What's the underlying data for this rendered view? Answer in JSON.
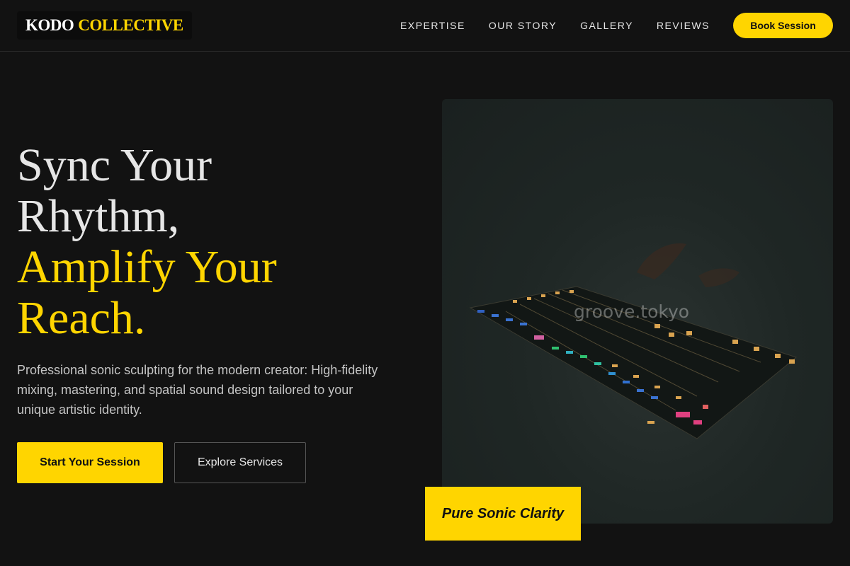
{
  "brand": {
    "name": "KODO",
    "accent": "COLLECTIVE"
  },
  "nav": {
    "links": [
      "EXPERTISE",
      "OUR STORY",
      "GALLERY",
      "REVIEWS"
    ],
    "cta": "Book Session"
  },
  "hero": {
    "title_lines": [
      "Sync Your",
      "Rhythm,"
    ],
    "title_accent_lines": [
      "Amplify Your",
      "Reach."
    ],
    "description": "Professional sonic sculpting for the modern creator: High-fidelity mixing, mastering, and spatial sound design tailored to your unique artistic identity.",
    "primary_button": "Start Your Session",
    "secondary_button": "Explore Services",
    "image": {
      "watermark": "groove.tokyo",
      "alt": "audio-mixer-icon"
    },
    "tagline": "Pure Sonic Clarity"
  },
  "colors": {
    "background": "#121212",
    "accent": "#ffd500",
    "text": "#e6e6e6",
    "muted_text": "#c4c4c4"
  }
}
